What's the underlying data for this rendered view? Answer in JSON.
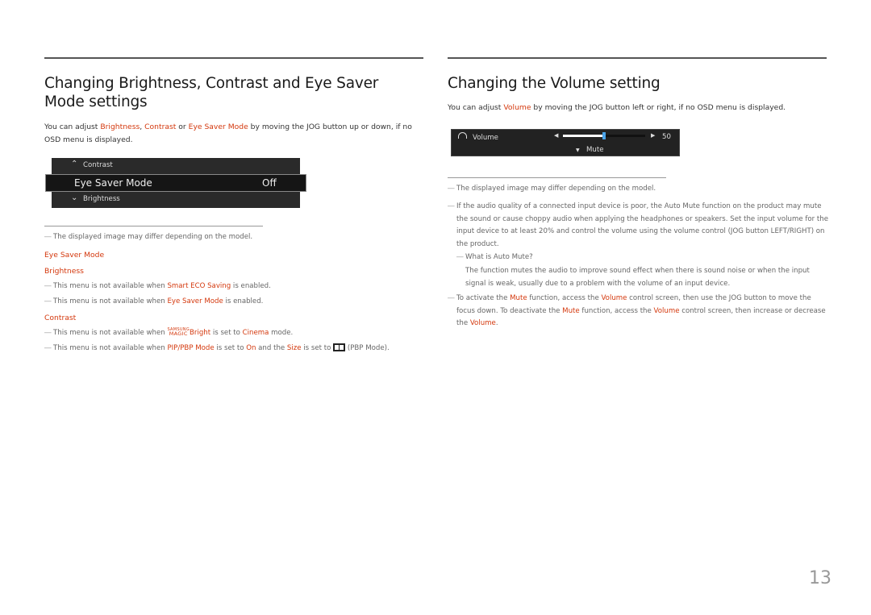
{
  "left": {
    "title": "Changing Brightness, Contrast and Eye Saver Mode settings",
    "intro": {
      "t1": "You can adjust ",
      "k1": "Brightness",
      "t2": ", ",
      "k2": "Contrast",
      "t3": " or ",
      "k3": "Eye Saver Mode",
      "t4": " by moving the JOG button up or down, if no OSD menu is displayed."
    },
    "osd": {
      "up_item": "Contrast",
      "selected_item": "Eye Saver Mode",
      "selected_value": "Off",
      "down_item": "Brightness"
    },
    "note_image": "The displayed image may differ depending on the model.",
    "sections": {
      "eye_saver": "Eye Saver Mode",
      "brightness": "Brightness",
      "brightness_note1": {
        "t1": "This menu is not available when ",
        "k1": "Smart ECO Saving",
        "t2": " is enabled."
      },
      "brightness_note2": {
        "t1": "This menu is not available when ",
        "k1": "Eye Saver Mode",
        "t2": " is enabled."
      },
      "contrast": "Contrast",
      "contrast_note1": {
        "t1": "This menu is not available when ",
        "logo_top": "SAMSUNG",
        "logo_bottom": "MAGIC",
        "k1": "Bright",
        "t2": " is set to ",
        "k2": "Cinema",
        "t3": " mode."
      },
      "contrast_note2": {
        "t1": "This menu is not available when ",
        "k1": "PIP/PBP Mode",
        "t2": " is set to ",
        "k2": "On",
        "t3": " and the ",
        "k3": "Size",
        "t4": " is set to ",
        "t5": " (PBP Mode)."
      }
    }
  },
  "right": {
    "title": "Changing the Volume setting",
    "intro": {
      "t1": "You can adjust ",
      "k1": "Volume",
      "t2": " by moving the JOG button left or right, if no OSD menu is displayed."
    },
    "osd": {
      "label": "Volume",
      "value": "50",
      "level_percent": 50,
      "mute_label": "Mute"
    },
    "note_image": "The displayed image may differ depending on the model.",
    "note_audio": "If the audio quality of a connected input device is poor, the Auto Mute function on the product may mute the sound or cause choppy audio when applying the headphones or speakers. Set the input volume for the input device to at least 20% and control the volume using the volume control (JOG button LEFT/RIGHT) on the product.",
    "auto_mute_q": "What is Auto Mute?",
    "auto_mute_a": "The function mutes the audio to improve sound effect when there is sound noise or when the input signal is weak, usually due to a problem with the volume of an input device.",
    "note_mute": {
      "t1": "To activate the ",
      "k1": "Mute",
      "t2": " function, access the ",
      "k2": "Volume",
      "t3": " control screen, then use the JOG button to move the focus down. To deactivate the ",
      "k3": "Mute",
      "t4": " function, access the ",
      "k4": "Volume",
      "t5": " control screen, then increase or decrease the ",
      "k5": "Volume",
      "t6": "."
    }
  },
  "page_number": "13"
}
